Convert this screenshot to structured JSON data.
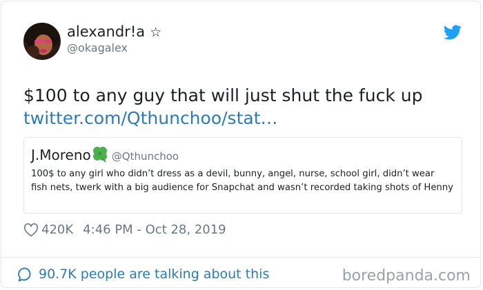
{
  "author": {
    "display_name": "alexandr!a",
    "star_glyph": "☆",
    "handle": "@okagalex"
  },
  "tweet": {
    "text": "$100 to any guy that will just shut the fuck up",
    "link": "twitter.com/Qthunchoo/stat…"
  },
  "quoted": {
    "name": "J.Moreno",
    "emoji": "four-leaf-clover",
    "handle": "@Qthunchoo",
    "text": "100$ to any girl who didn’t dress as a devil, bunny, angel, nurse, school girl, didn’t wear fish nets, twerk with a big audience for Snapchat and wasn’t recorded taking shots of Henny"
  },
  "meta": {
    "likes": "420K",
    "timestamp": "4:46 PM - Oct 28, 2019"
  },
  "footer": {
    "talking": "90.7K people are talking about this"
  },
  "watermark": "boredpanda.com",
  "icons": {
    "brand": "twitter-bird-icon",
    "like": "heart-icon",
    "conversation": "speech-bubble-icon",
    "favorite": "star-icon"
  },
  "colors": {
    "link": "#2b7bb9",
    "twitter_blue": "#1da1f2",
    "secondary_text": "#697882",
    "border": "#e1e8ed",
    "clover": "#4cb050"
  }
}
